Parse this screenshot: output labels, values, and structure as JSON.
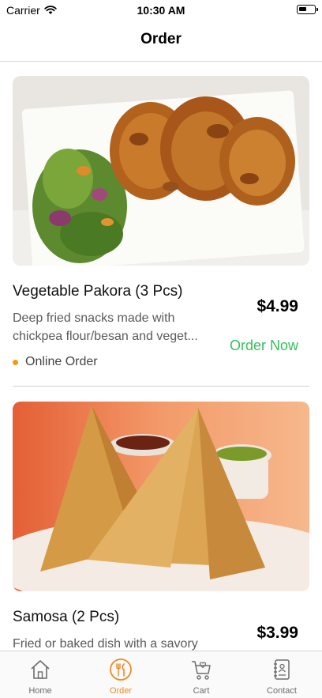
{
  "status_bar": {
    "carrier": "Carrier",
    "time": "10:30 AM"
  },
  "header": {
    "title": "Order"
  },
  "products": [
    {
      "name": "Vegetable Pakora (3 Pcs)",
      "description_line1": "Deep fried snacks made with",
      "description_line2": "chickpea flour/besan and veget...",
      "price": "$4.99",
      "order_label": "Order Now",
      "tag": "Online Order",
      "image": "vegetable-pakora-photo"
    },
    {
      "name": "Samosa (2 Pcs)",
      "description_line1": "Fried or baked dish with a savory",
      "price": "$3.99",
      "image": "samosa-photo"
    }
  ],
  "tab_bar": {
    "items": [
      {
        "label": "Home",
        "icon": "home-icon",
        "active": false
      },
      {
        "label": "Order",
        "icon": "cutlery-icon",
        "active": true
      },
      {
        "label": "Cart",
        "icon": "cart-icon",
        "active": false
      },
      {
        "label": "Contact",
        "icon": "contact-book-icon",
        "active": false
      }
    ]
  },
  "colors": {
    "accent": "#f08a24",
    "order_now": "#34c25a",
    "tag_dot": "#f39c12"
  }
}
